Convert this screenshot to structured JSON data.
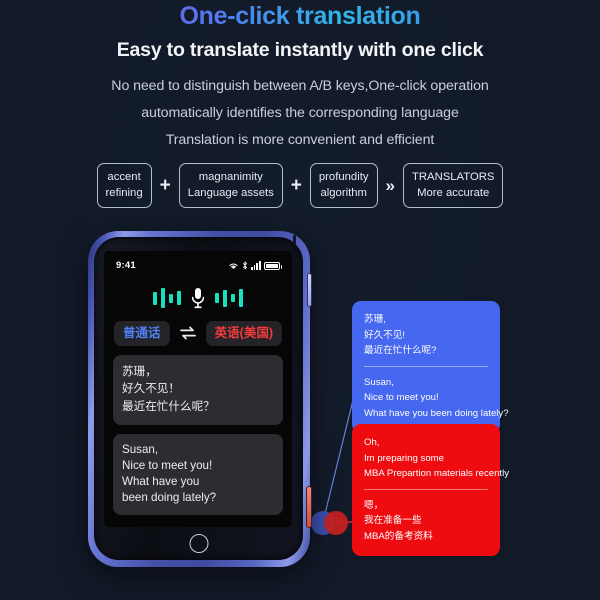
{
  "header": {
    "title": "One-click translation",
    "subtitle": "Easy to translate instantly with one click",
    "desc_line1": "No need to distinguish between A/B keys,One-click operation",
    "desc_line2": "automatically identifies the corresponding language",
    "desc_line3": "Translation is more convenient and efficient"
  },
  "badges": [
    {
      "line1": "accent",
      "line2": "refining"
    },
    {
      "line1": "magnanimity",
      "line2": "Language assets"
    },
    {
      "line1": "profundity",
      "line2": "algorithm"
    },
    {
      "line1": "TRANSLATORS",
      "line2": "More accurate"
    }
  ],
  "separators": {
    "plus": "+",
    "chevron": "»"
  },
  "device": {
    "status_bar": {
      "clock": "9:41",
      "icons": [
        "wifi-icon",
        "bluetooth-icon",
        "cellular-signal-icon",
        "battery-icon"
      ]
    },
    "mic_icon": "microphone-icon",
    "waveform_left": [
      13,
      20,
      9,
      14
    ],
    "waveform_right": [
      10,
      17,
      8,
      18
    ],
    "waveform_color": "#18e0c0",
    "language_source": "普通话",
    "language_target": "英语(美国)",
    "swap_icon": "swap-arrows-icon",
    "source_color": "#4f7ff5",
    "target_color": "#f23b3b",
    "bubble_cn": [
      "苏珊，",
      "好久不见！",
      "最近在忙什么呢？"
    ],
    "bubble_en": [
      "Susan,",
      "Nice to meet you!",
      "What have you",
      "been doing lately?"
    ],
    "home_button": "home-button",
    "side_button_top": "volume-button",
    "side_button_red": "translate-button"
  },
  "callout_blue": {
    "color": "#4667ef",
    "cn": [
      "苏珊,",
      "好久不见!",
      "最近在忙什么呢?"
    ],
    "en": [
      "Susan,",
      "Nice to meet you!",
      "What have you been doing lately?"
    ]
  },
  "callout_red": {
    "color": "#ee0c11",
    "en": [
      "Oh,",
      "Im preparing some",
      "MBA Prepartion materials recently"
    ],
    "cn": [
      "嗯，",
      "我在准备一些",
      "MBA的备考资料"
    ]
  },
  "background_color": "#121a28"
}
